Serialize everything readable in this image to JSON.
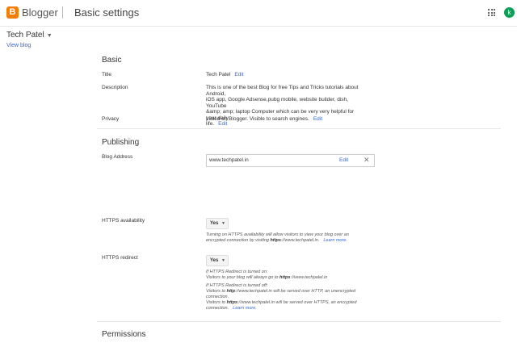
{
  "topbar": {
    "logo_letter": "B",
    "brand": "Blogger",
    "page_title": "Basic settings",
    "avatar_initial": "k"
  },
  "blog": {
    "name": "Tech Patel",
    "view_blog": "View blog"
  },
  "basic": {
    "heading": "Basic",
    "title_label": "Title",
    "title_value": "Tech Patel",
    "title_edit": "Edit",
    "description_label": "Description",
    "description_lines": [
      "This is one of the best Blog for free Tips and Tricks tutorials about Android,",
      "iOS app, Google Adsense,pubg mobile, website builder, dish, YouTube",
      "&amp; amp; laptop Computer which can be very very helpful for your daily",
      "life."
    ],
    "description_edit": "Edit",
    "privacy_label": "Privacy",
    "privacy_value": "Listed on Blogger. Visible to search engines.",
    "privacy_edit": "Edit"
  },
  "publishing": {
    "heading": "Publishing",
    "address_label": "Blog Address",
    "address_value": "www.techpatel.in",
    "address_edit": "Edit",
    "address_close": "✕",
    "https_avail_label": "HTTPS availability",
    "https_avail_value": "Yes",
    "https_avail_note_1": "Turning on HTTPS availability will allow visitors to view your blog over an",
    "https_avail_note_2a": "encrypted connection by visiting ",
    "https_avail_note_2b": "https",
    "https_avail_note_2c": "://www.techpatel.in.",
    "https_avail_learn": "Learn more.",
    "https_redirect_label": "HTTPS redirect",
    "https_redirect_value": "Yes",
    "redirect_on_1": "If HTTPS Redirect is turned on:",
    "redirect_on_2a": "Visitors to your blog will always go to ",
    "redirect_on_2b": "https",
    "redirect_on_2c": "://www.techpatel.in",
    "redirect_off_1": "If HTTPS Redirect is turned off:",
    "redirect_off_2a": "Visitors to ",
    "redirect_off_2b": "http",
    "redirect_off_2c": "://www.techpatel.in will be served over HTTP, an unencrypted",
    "redirect_off_3": "connection.",
    "redirect_off_4a": "Visitors to ",
    "redirect_off_4b": "https",
    "redirect_off_4c": "://www.techpatel.in will be served over HTTPS, an encrypted",
    "redirect_off_5": "connection.",
    "redirect_learn": "Learn more."
  },
  "permissions": {
    "heading": "Permissions"
  },
  "colors": {
    "accent": "#3367d6",
    "logo": "#f57d00",
    "avatar": "#0f9d58"
  },
  "icons": {
    "apps": "apps-grid-icon",
    "caret": "caret-down-icon",
    "close": "close-icon"
  }
}
